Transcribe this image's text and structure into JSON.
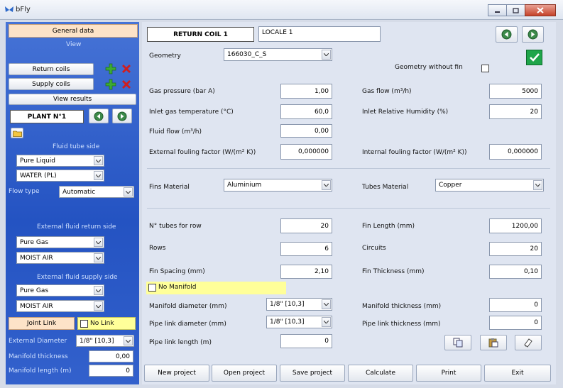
{
  "window": {
    "title": "bFly"
  },
  "sidebar": {
    "general_data": "General data",
    "view": "View",
    "return_coils": "Return coils",
    "supply_coils": "Supply coils",
    "view_results": "View results",
    "plant_name": "PLANT N°1",
    "fluid_tube_side": "Fluid tube side",
    "tube_fluid_type": "Pure Liquid",
    "tube_fluid": "WATER (PL)",
    "flow_type_label": "Flow type",
    "flow_type": "Automatic",
    "ext_return_side": "External fluid return side",
    "return_fluid_type": "Pure Gas",
    "return_fluid": "MOIST AIR",
    "ext_supply_side": "External fluid supply side",
    "supply_fluid_type": "Pure Gas",
    "supply_fluid": "MOIST AIR",
    "joint_link": "Joint Link",
    "no_link": "No Link",
    "external_diameter_label": "External Diameter",
    "external_diameter": "1/8\" [10,3]",
    "manifold_thickness_label": "Manifold thickness",
    "manifold_thickness": "0,00",
    "manifold_length_label": "Manifold length (m)",
    "manifold_length": "0"
  },
  "main": {
    "coil_title": "RETURN COIL 1",
    "locale": "LOCALE 1",
    "geometry_label": "Geometry",
    "geometry": "166030_C_S",
    "geometry_without_fin": "Geometry without fin",
    "gas_pressure_label": "Gas pressure (bar A)",
    "gas_pressure": "1,00",
    "gas_flow_label": "Gas flow (m³/h)",
    "gas_flow": "5000",
    "inlet_gas_temp_label": "Inlet gas temperature (°C)",
    "inlet_gas_temp": "60,0",
    "inlet_rh_label": "Inlet Relative Humidity (%)",
    "inlet_rh": "20",
    "fluid_flow_label": "Fluid flow (m³/h)",
    "fluid_flow": "0,00",
    "ext_fouling_label": "External fouling factor (W/(m² K))",
    "ext_fouling": "0,000000",
    "int_fouling_label": "Internal fouling factor (W/(m² K))",
    "int_fouling": "0,000000",
    "fins_material_label": "Fins Material",
    "fins_material": "Aluminium",
    "tubes_material_label": "Tubes Material",
    "tubes_material": "Copper",
    "tubes_per_row_label": "N° tubes for row",
    "tubes_per_row": "20",
    "fin_length_label": "Fin Length (mm)",
    "fin_length": "1200,00",
    "rows_label": "Rows",
    "rows": "6",
    "circuits_label": "Circuits",
    "circuits": "20",
    "fin_spacing_label": "Fin Spacing (mm)",
    "fin_spacing": "2,10",
    "fin_thickness_label": "Fin Thickness (mm)",
    "fin_thickness": "0,10",
    "no_manifold": "No Manifold",
    "manifold_diameter_label": "Manifold diameter (mm)",
    "manifold_diameter": "1/8\" [10,3]",
    "manifold_thickness_label": "Manifold thickness (mm)",
    "manifold_thickness": "0",
    "pipe_link_diameter_label": "Pipe link diameter (mm)",
    "pipe_link_diameter": "1/8\" [10,3]",
    "pipe_link_thickness_label": "Pipe link thickness (mm)",
    "pipe_link_thickness": "0",
    "pipe_link_length_label": "Pipe link length (m)",
    "pipe_link_length": "0"
  },
  "footer": {
    "new_project": "New project",
    "open_project": "Open project",
    "save_project": "Save project",
    "calculate": "Calculate",
    "print": "Print",
    "exit": "Exit"
  },
  "colors": {
    "sidebar_blue": "#2f5fcc",
    "highlight_yellow": "#ffff99",
    "header_peach": "#fde3c8",
    "ok_green": "#1fa54a"
  },
  "icons": [
    "app-butterfly-icon",
    "add-icon",
    "delete-icon",
    "prev-icon",
    "next-icon",
    "folder-icon",
    "checkmark-icon",
    "copy-icon",
    "paste-icon",
    "eraser-icon"
  ]
}
